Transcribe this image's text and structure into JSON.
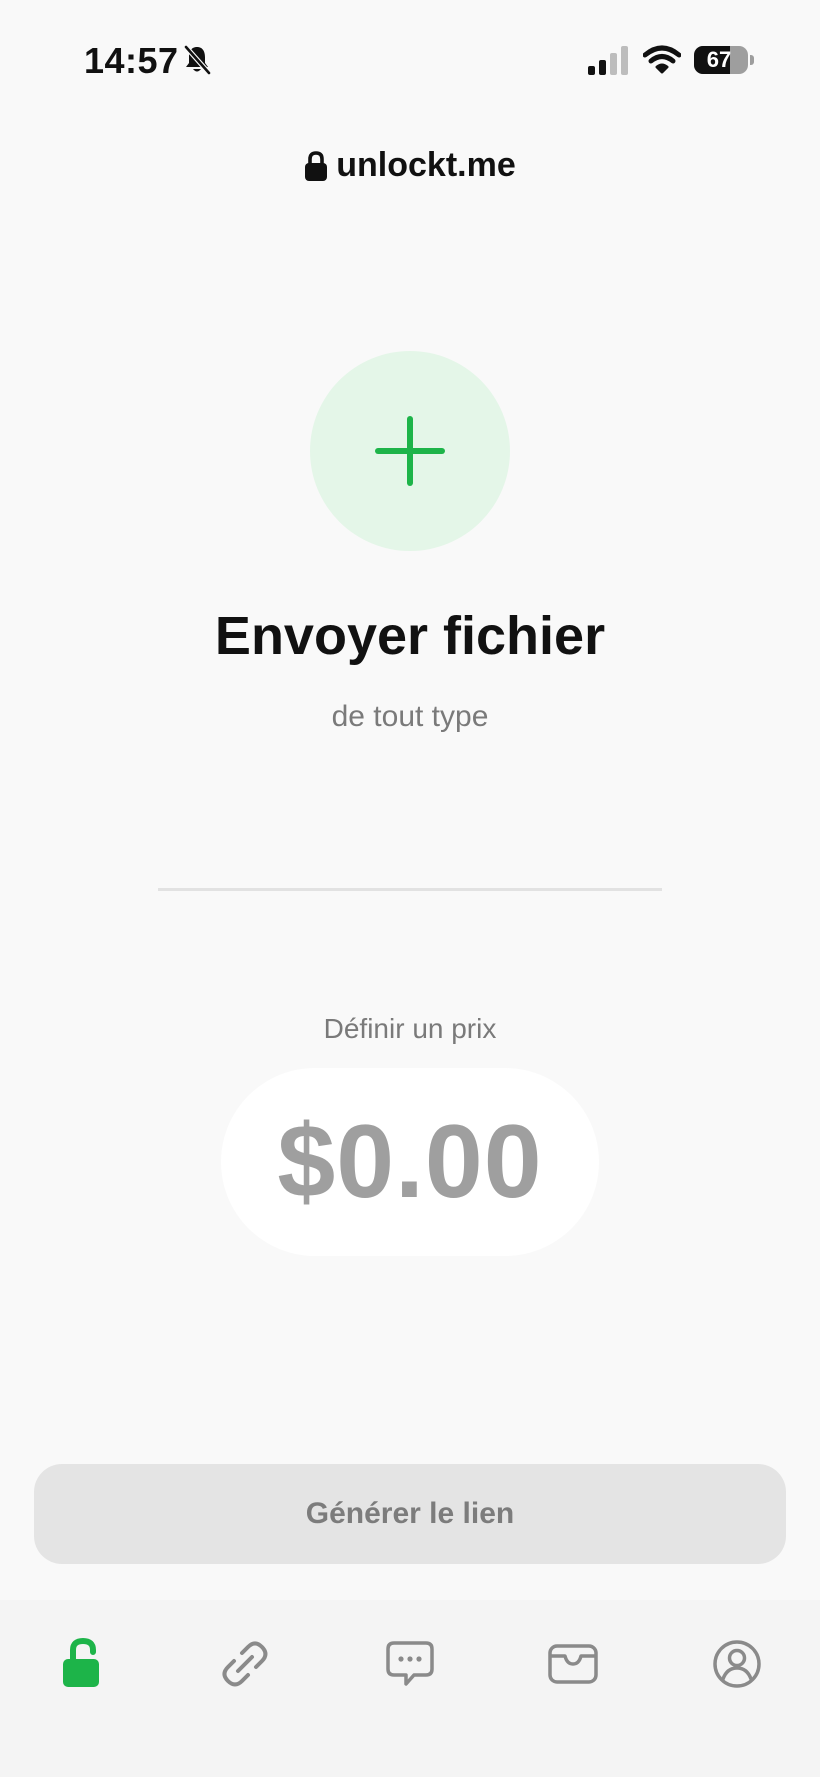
{
  "status_bar": {
    "time": "14:57",
    "battery_level": 67,
    "battery_text": "67",
    "icons": [
      "bell-slash-icon",
      "signal-icon",
      "wifi-icon",
      "battery-icon"
    ]
  },
  "header": {
    "brand": "unlockt.me",
    "brand_icon": "lock-icon"
  },
  "upload": {
    "icon": "plus-icon",
    "title": "Envoyer fichier",
    "subtitle": "de tout type"
  },
  "price": {
    "label": "Définir un prix",
    "value": "$0.00"
  },
  "actions": {
    "generate_label": "Générer le lien"
  },
  "tab_bar": {
    "items": [
      {
        "name": "tab-unlock",
        "icon": "unlock-icon",
        "active": true
      },
      {
        "name": "tab-link",
        "icon": "link-icon",
        "active": false
      },
      {
        "name": "tab-messages",
        "icon": "chat-bubble-icon",
        "active": false
      },
      {
        "name": "tab-wallet",
        "icon": "wallet-icon",
        "active": false
      },
      {
        "name": "tab-profile",
        "icon": "profile-icon",
        "active": false
      }
    ]
  },
  "colors": {
    "accent": "#1db449",
    "accent_light": "#e4f6e8",
    "background": "#f9f9f9",
    "muted_text": "#7a7a7a",
    "tab_inactive": "#8a8a8a"
  }
}
